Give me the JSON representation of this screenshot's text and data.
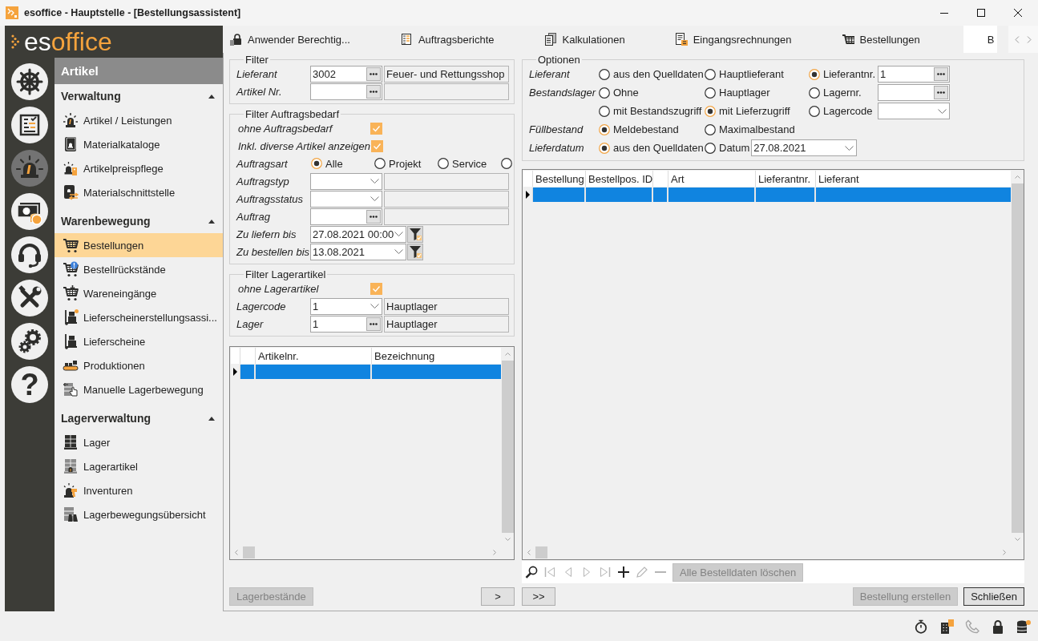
{
  "window": {
    "title": "esoffice - Hauptstelle - [Bestellungsassistent]"
  },
  "sidebar": {
    "logo": [
      "es",
      "office"
    ],
    "modules": [
      {
        "kind": "helm",
        "selected": false
      },
      {
        "kind": "board",
        "selected": false
      },
      {
        "kind": "beacon",
        "selected": true
      },
      {
        "kind": "money",
        "selected": false
      },
      {
        "kind": "headset",
        "selected": false
      },
      {
        "kind": "tools",
        "selected": false
      },
      {
        "kind": "gears",
        "selected": false
      },
      {
        "kind": "help",
        "glyph": "?",
        "selected": false
      }
    ],
    "panel": {
      "title": "Artikel",
      "sections": [
        {
          "title": "Verwaltung",
          "expanded": true,
          "items": [
            {
              "kind": "beacon",
              "label": "Artikel / Leistungen",
              "selected": false
            },
            {
              "kind": "catalog",
              "label": "Materialkataloge",
              "selected": false
            },
            {
              "kind": "pricing",
              "label": "Artikelpreispflege",
              "selected": false
            },
            {
              "kind": "interface",
              "label": "Materialschnittstelle",
              "selected": false
            }
          ]
        },
        {
          "title": "Warenbewegung",
          "expanded": true,
          "items": [
            {
              "kind": "cart",
              "label": "Bestellungen",
              "selected": true
            },
            {
              "kind": "cart_alert",
              "label": "Bestellrückstände",
              "selected": false
            },
            {
              "kind": "cart_in",
              "label": "Wareneingänge",
              "selected": false
            },
            {
              "kind": "truck_new",
              "label": "Lieferscheinerstellungsassi...",
              "selected": false
            },
            {
              "kind": "truck",
              "label": "Lieferscheine",
              "selected": false
            },
            {
              "kind": "conveyor",
              "label": "Produktionen",
              "selected": false
            },
            {
              "kind": "manual",
              "label": "Manuelle Lagerbewegung",
              "selected": false
            }
          ]
        },
        {
          "title": "Lagerverwaltung",
          "expanded": true,
          "items": [
            {
              "kind": "stock",
              "label": "Lager",
              "selected": false
            },
            {
              "kind": "stock_item",
              "label": "Lagerartikel",
              "selected": false
            },
            {
              "kind": "inventory",
              "label": "Inventuren",
              "selected": false
            },
            {
              "kind": "overview",
              "label": "Lagerbewegungsübersicht",
              "selected": false
            }
          ]
        }
      ]
    }
  },
  "tabs": [
    {
      "kind": "lock",
      "label": "Anwender Berechtig...",
      "selected": false
    },
    {
      "kind": "report",
      "label": "Auftragsberichte",
      "selected": false
    },
    {
      "kind": "calc",
      "label": "Kalkulationen",
      "selected": false
    },
    {
      "kind": "invoice",
      "label": "Eingangsrechnungen",
      "selected": false
    },
    {
      "kind": "cart",
      "label": "Bestellungen",
      "selected": false
    },
    {
      "label": "B",
      "selected": true
    }
  ],
  "filter_groups": [
    {
      "title": "Filter",
      "rows": [
        {
          "kind": "lookup",
          "label": "Lieferant",
          "value": "3002",
          "description": "Feuer- und Rettungsshop"
        },
        {
          "kind": "lookup",
          "label": "Artikel Nr."
        }
      ]
    },
    {
      "title": "Filter Auftragsbedarf",
      "rows": [
        {
          "kind": "checkbox",
          "label": "ohne Auftragsbedarf",
          "checked": true
        },
        {
          "kind": "checkbox",
          "label": "Inkl. diverse Artikel anzeigen",
          "checked": true
        },
        {
          "kind": "radio",
          "label": "Auftragsart",
          "options": [
            {
              "label": "Alle",
              "selected": true
            },
            {
              "label": "Projekt",
              "selected": false
            },
            {
              "label": "Service",
              "selected": false
            },
            {
              "selected": false
            }
          ]
        },
        {
          "kind": "combo",
          "label": "Auftragstyp"
        },
        {
          "kind": "combo",
          "label": "Auftragsstatus"
        },
        {
          "kind": "lookup",
          "label": "Auftrag"
        },
        {
          "kind": "date",
          "label": "Zu liefern bis",
          "value": "27.08.2021 00:00"
        },
        {
          "kind": "date",
          "label": "Zu bestellen bis",
          "value": "13.08.2021"
        }
      ]
    },
    {
      "title": "Filter Lagerartikel",
      "rows": [
        {
          "kind": "checkbox",
          "label": "ohne Lagerartikel",
          "checked": true
        },
        {
          "kind": "combo",
          "label": "Lagercode",
          "value": "1",
          "description": "Hauptlager"
        },
        {
          "kind": "lookup",
          "label": "Lager",
          "value": "1",
          "description": "Hauptlager"
        }
      ]
    }
  ],
  "article_table": {
    "columns": [
      {
        "kind": "blank"
      },
      {
        "kind": "text",
        "label": "Artikelnr."
      },
      {
        "kind": "text",
        "label": "Bezeichnung"
      }
    ],
    "rows": [
      {
        "selected": true
      }
    ]
  },
  "options": {
    "title": "Optionen",
    "groups": [
      {
        "label": "Lieferant",
        "options": [
          {
            "label": "aus den Quelldaten",
            "selected": false
          },
          {
            "label": "Hauptlieferant",
            "selected": false
          },
          {
            "label": "Lieferantnr.",
            "selected": true,
            "field": {
              "kind": "lookup",
              "value": "1"
            }
          }
        ]
      },
      {
        "label": "Bestandslager",
        "options": [
          {
            "label": "Ohne",
            "selected": false
          },
          {
            "label": "Hauptlager",
            "selected": false
          },
          {
            "label": "Lagernr.",
            "selected": false,
            "field": {
              "kind": "lookup"
            }
          },
          {
            "label": "mit Bestandszugriff",
            "selected": false
          },
          {
            "label": "mit Lieferzugriff",
            "selected": true
          },
          {
            "label": "Lagercode",
            "selected": false,
            "field": {
              "kind": "combo"
            }
          }
        ]
      },
      {
        "label": "Füllbestand",
        "options": [
          {
            "label": "Meldebestand",
            "selected": true
          },
          {
            "label": "Maximalbestand",
            "selected": false
          }
        ]
      },
      {
        "label": "Lieferdatum",
        "options": [
          {
            "label": "aus den Quelldaten",
            "selected": true
          },
          {
            "label": "Datum",
            "selected": false,
            "field": {
              "kind": "combo",
              "value": "27.08.2021"
            }
          }
        ]
      }
    ]
  },
  "order_table": {
    "columns": [
      {
        "kind": "text",
        "label": "Bestellung"
      },
      {
        "kind": "text",
        "label": "Bestellpos. ID"
      },
      {
        "kind": "blank"
      },
      {
        "kind": "text",
        "label": "Art"
      },
      {
        "kind": "text",
        "label": "Lieferantnr."
      },
      {
        "kind": "text",
        "label": "Lieferant"
      }
    ],
    "rows": [
      {
        "selected": true
      }
    ]
  },
  "navigator": {
    "buttons": [
      {
        "kind": "search",
        "disabled": false
      },
      {
        "kind": "first",
        "disabled": true
      },
      {
        "kind": "prev",
        "disabled": true
      },
      {
        "kind": "next",
        "disabled": true
      },
      {
        "kind": "last",
        "disabled": true
      },
      {
        "kind": "add",
        "disabled": false
      },
      {
        "kind": "edit",
        "disabled": true
      },
      {
        "kind": "remove",
        "disabled": true
      }
    ],
    "action": {
      "label": "Alle Bestelldaten löschen",
      "disabled": true
    }
  },
  "footer": {
    "left": [
      {
        "label": "Lagerbestände",
        "disabled": true,
        "focused": false
      },
      {
        "label": ">",
        "disabled": false,
        "focused": false
      }
    ],
    "right": [
      {
        "label": ">>",
        "disabled": false,
        "focused": false
      },
      {
        "label": "Bestellung erstellen",
        "disabled": true,
        "focused": false
      },
      {
        "label": "Schließen",
        "disabled": false,
        "focused": true
      }
    ]
  },
  "status_bar": {
    "icons": [
      {
        "kind": "stopwatch",
        "disabled": false
      },
      {
        "kind": "building",
        "disabled": false
      },
      {
        "kind": "phone",
        "disabled": true
      },
      {
        "kind": "lock",
        "disabled": false
      },
      {
        "kind": "database",
        "disabled": false
      }
    ]
  }
}
